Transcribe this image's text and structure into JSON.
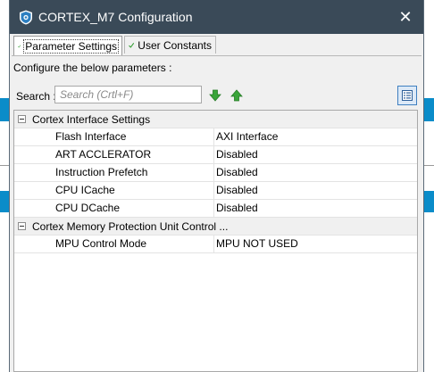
{
  "window": {
    "title": "CORTEX_M7 Configuration",
    "close_glyph": "✕",
    "title_bar_color": "#3a4a58"
  },
  "tabs": [
    {
      "label": "Parameter Settings",
      "active": true,
      "icon": "green-check-icon"
    },
    {
      "label": "User Constants",
      "active": false,
      "icon": "green-check-icon"
    }
  ],
  "panel": {
    "configure_text": "Configure the below parameters :",
    "search_label": "Search :",
    "search_placeholder": "Search (Crtl+F)",
    "search_value": ""
  },
  "groups": [
    {
      "title": "Cortex Interface Settings",
      "rows": [
        {
          "name": "Flash Interface",
          "value": "AXI Interface"
        },
        {
          "name": "ART ACCLERATOR",
          "value": "Disabled"
        },
        {
          "name": "Instruction Prefetch",
          "value": "Disabled"
        },
        {
          "name": "CPU ICache",
          "value": "Disabled"
        },
        {
          "name": "CPU DCache",
          "value": "Disabled"
        }
      ]
    },
    {
      "title": "Cortex Memory Protection Unit Control ...",
      "rows": [
        {
          "name": "MPU Control Mode",
          "value": "MPU NOT USED"
        }
      ]
    }
  ],
  "colors": {
    "accent": "#0a8cc9",
    "green_arrow": "#3aa53a",
    "check": "#2e9b2e"
  }
}
